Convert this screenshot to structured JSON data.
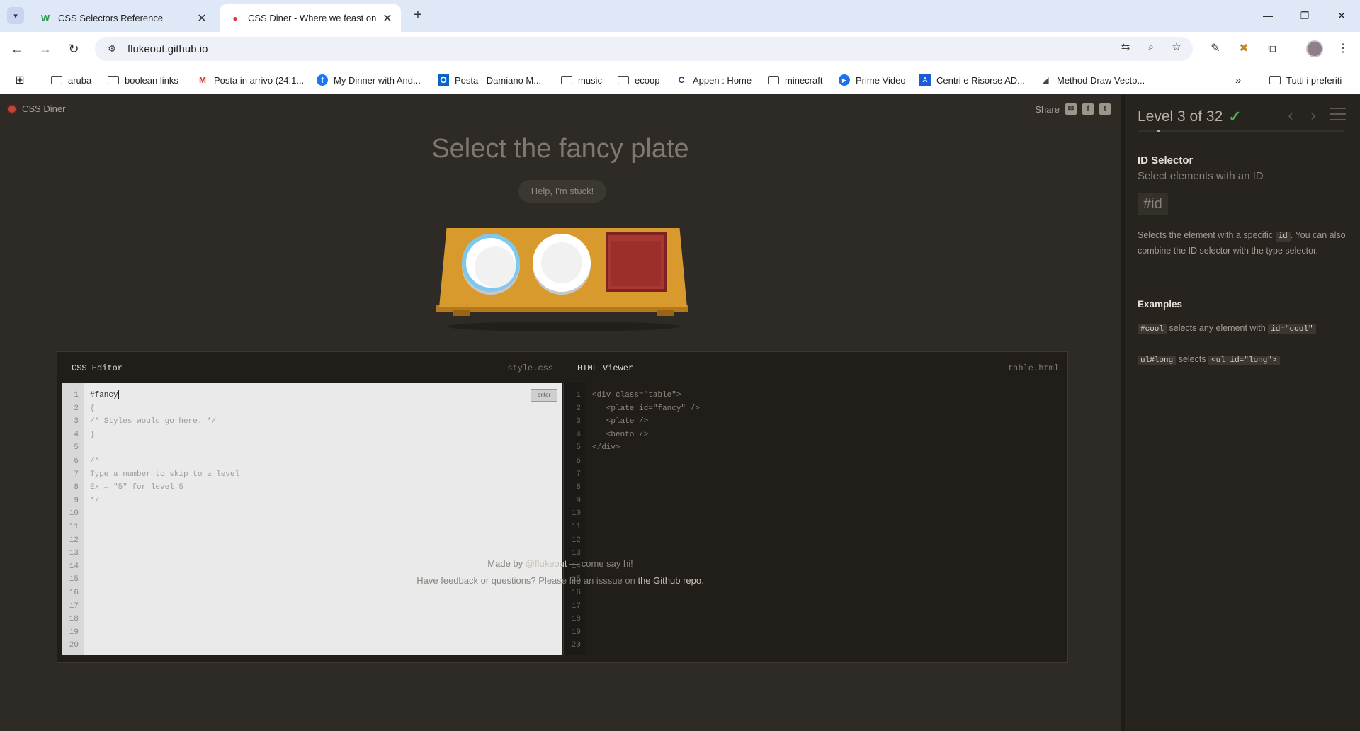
{
  "browser": {
    "tabs": [
      {
        "title": "CSS Selectors Reference",
        "favicon": "W",
        "active": false
      },
      {
        "title": "CSS Diner - Where we feast on",
        "favicon": "●",
        "active": true
      }
    ],
    "url": "flukeout.github.io",
    "bookmarks": [
      {
        "label": "aruba",
        "icon": "folder"
      },
      {
        "label": "boolean links",
        "icon": "folder"
      },
      {
        "label": "Posta in arrivo (24.1...",
        "icon": "M"
      },
      {
        "label": "My Dinner with And...",
        "icon": "f"
      },
      {
        "label": "Posta - Damiano M...",
        "icon": "O"
      },
      {
        "label": "music",
        "icon": "folder"
      },
      {
        "label": "ecoop",
        "icon": "folder"
      },
      {
        "label": "Appen : Home",
        "icon": "C"
      },
      {
        "label": "minecraft",
        "icon": "folder"
      },
      {
        "label": "Prime Video",
        "icon": "▶"
      },
      {
        "label": "Centri e Risorse AD...",
        "icon": "A"
      },
      {
        "label": "Method Draw Vecto...",
        "icon": "◢"
      }
    ],
    "bookmarks_overflow": "»",
    "all_bookmarks": "Tutti i preferiti"
  },
  "game": {
    "brand": "CSS Diner",
    "share_label": "Share",
    "order": "Select the fancy plate",
    "help_button": "Help, I'm stuck!",
    "css_editor": {
      "title": "CSS Editor",
      "file": "style.css",
      "enter_label": "enter",
      "input_value": "#fancy",
      "lines": [
        "{",
        "/* Styles would go here. */",
        "}",
        "",
        "/*",
        "Type a number to skip to a level.",
        "Ex → \"5\" for level 5",
        "*/"
      ]
    },
    "html_viewer": {
      "title": "HTML Viewer",
      "file": "table.html",
      "lines": [
        "<div class=\"table\">",
        "   <plate id=\"fancy\" />",
        "   <plate />",
        "   <bento />",
        "</div>"
      ]
    },
    "line_numbers": [
      "1",
      "2",
      "3",
      "4",
      "5",
      "6",
      "7",
      "8",
      "9",
      "10",
      "11",
      "12",
      "13",
      "14",
      "15",
      "16",
      "17",
      "18",
      "19",
      "20"
    ],
    "footer": {
      "made_by_prefix": "Made by ",
      "made_by_link": "@flukeout",
      "made_by_suffix": " — come say hi!",
      "feedback_prefix": "Have feedback or questions? Please file an isssue on ",
      "feedback_link": "the Github repo",
      "feedback_suffix": "."
    }
  },
  "sidebar": {
    "level": "Level 3 of 32",
    "completed": true,
    "selector_name": "ID Selector",
    "selector_title": "Select elements with an ID",
    "syntax": "#id",
    "hint_1": "Selects the element with a specific ",
    "hint_code": "id",
    "hint_2": ". You can also combine the ID selector with the type selector.",
    "examples_title": "Examples",
    "examples": [
      {
        "code": "#cool",
        "text": " selects any element with ",
        "code2": "id=\"cool\""
      },
      {
        "code": "ul#long",
        "text": " selects ",
        "code2": "<ul id=\"long\">"
      }
    ]
  },
  "colors": {
    "background": "#2e2b26",
    "plate_fancy_border": "#7fc8ed",
    "bento": "#a83632",
    "table": "#d99a2d",
    "check": "#4caf50"
  }
}
